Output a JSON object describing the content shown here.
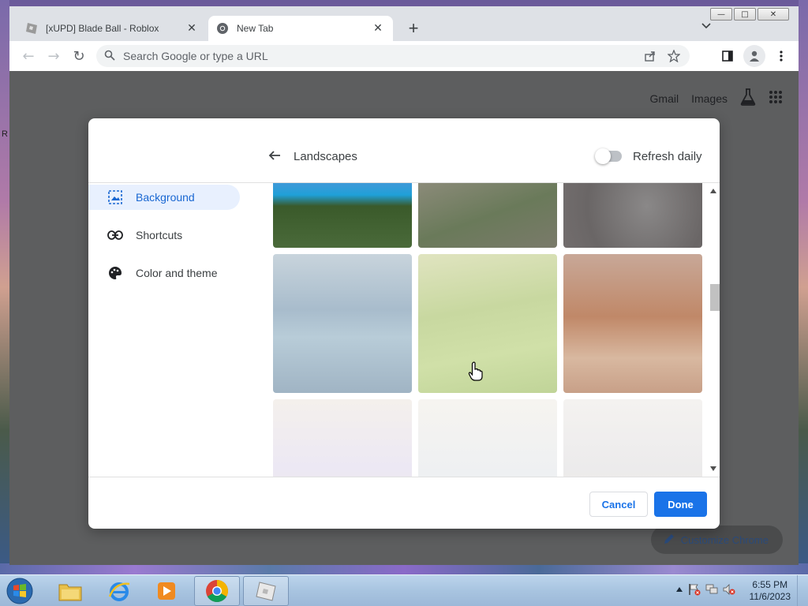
{
  "window_controls": {
    "minimize": "—",
    "maximize": "□",
    "close": "✕"
  },
  "tabs": [
    {
      "title": "[xUPD] Blade Ball - Roblox",
      "close": "✕"
    },
    {
      "title": "New Tab",
      "close": "✕"
    }
  ],
  "new_tab_label": "+",
  "tab_search_icon": "chevron-down-icon",
  "toolbar": {
    "back": "←",
    "forward": "→",
    "reload": "↻",
    "omnibox_placeholder": "Search Google or type a URL"
  },
  "page": {
    "links": [
      "Gmail",
      "Images"
    ],
    "customize_label": "Customize Chrome"
  },
  "dialog": {
    "title": "Landscapes",
    "refresh_daily_label": "Refresh daily",
    "refresh_daily_on": false,
    "nav": [
      {
        "label": "Background",
        "icon": "image-icon",
        "selected": true
      },
      {
        "label": "Shortcuts",
        "icon": "link-icon",
        "selected": false
      },
      {
        "label": "Color and theme",
        "icon": "palette-icon",
        "selected": false
      }
    ],
    "cancel_label": "Cancel",
    "done_label": "Done"
  },
  "taskbar": {
    "time": "6:55 PM",
    "date": "11/6/2023"
  },
  "colors": {
    "accent": "#1a73e8",
    "selected_nav_bg": "#e8f0fe",
    "selected_nav_text": "#1967d2",
    "overlay": "#5d5e5f"
  },
  "side_letter": "R"
}
